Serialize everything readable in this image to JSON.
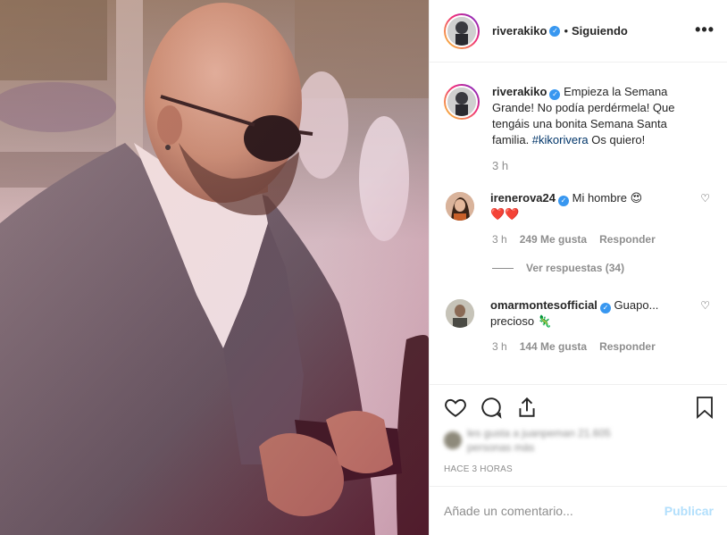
{
  "post": {
    "author": {
      "username": "riverakiko",
      "verified": true,
      "following_label": "Siguiendo",
      "separator": "•"
    },
    "more_icon": "more-options-icon",
    "caption": {
      "username": "riverakiko",
      "text_before": "Empieza la Semana Grande! No podía perdérmela! Que tengáis una bonita Semana Santa familia. ",
      "hashtag": "#kikorivera",
      "text_after": " Os quiero!",
      "time": "3 h"
    },
    "comments": [
      {
        "username": "irenerova24",
        "verified": true,
        "text": "Mi hombre 😍",
        "second_line": "❤️❤️",
        "time": "3 h",
        "likes": "249 Me gusta",
        "reply": "Responder",
        "view_replies": "Ver respuestas (34)"
      },
      {
        "username": "omarmontesofficial",
        "verified": true,
        "text": "Guapo...",
        "second_line": "precioso 🦎",
        "time": "3 h",
        "likes": "144 Me gusta",
        "reply": "Responder"
      }
    ],
    "actions": {
      "like_icon": "heart-icon",
      "comment_icon": "comment-icon",
      "share_icon": "share-icon",
      "save_icon": "bookmark-icon"
    },
    "timeago": "HACE 3 HORAS",
    "add_comment": {
      "placeholder": "Añade un comentario...",
      "publish_label": "Publicar"
    },
    "colors": {
      "accent": "#3897f0",
      "publish_disabled": "#b2dffc",
      "muted_text": "#8e8e8e"
    }
  }
}
